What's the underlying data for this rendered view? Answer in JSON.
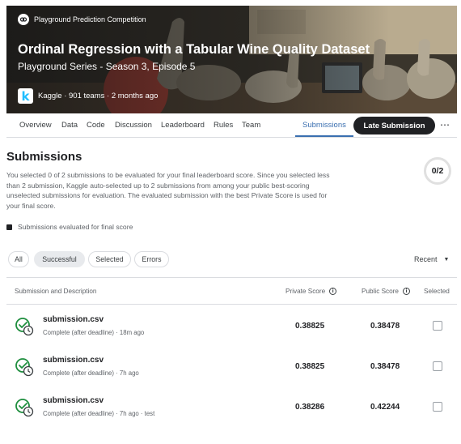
{
  "banner": {
    "competition_type": "Playground Prediction Competition",
    "title": "Ordinal Regression with a Tabular Wine Quality Dataset",
    "subtitle": "Playground Series - Season 3, Episode 5",
    "host_logo_letter": "k",
    "meta": "Kaggle · 901 teams · 2 months ago",
    "icons": [
      "competition-type-icon",
      "kaggle-logo"
    ]
  },
  "tabs": {
    "items": [
      "Overview",
      "Data",
      "Code",
      "Discussion",
      "Leaderboard",
      "Rules",
      "Team",
      "Submissions"
    ],
    "active": "Submissions",
    "late_submission_label": "Late Submission",
    "more_label": "⋯",
    "accent_color": "#3a6fb0"
  },
  "submissions": {
    "title": "Submissions",
    "description": "You selected 0 of 2 submissions to be evaluated for your final leaderboard score. Since you selected less than 2 submission, Kaggle auto-selected up to 2 submissions from among your public best-scoring unselected submissions for evaluation. The evaluated submission with the best Private Score is used for your final score.",
    "selected_count": "0/2",
    "legend_label": "Submissions evaluated for final score"
  },
  "filters": {
    "chips": [
      "All",
      "Successful",
      "Selected",
      "Errors"
    ],
    "active": "Successful",
    "sort_label": "Recent",
    "sort_icon": "caret-down-icon"
  },
  "table": {
    "headers": {
      "description": "Submission and Description",
      "private": "Private Score",
      "public": "Public Score",
      "selected": "Selected"
    },
    "info_glyph": "i",
    "rows": [
      {
        "file": "submission.csv",
        "meta": "Complete (after deadline) · 18m ago",
        "private": "0.38825",
        "public": "0.38478",
        "selected": false
      },
      {
        "file": "submission.csv",
        "meta": "Complete (after deadline) · 7h ago",
        "private": "0.38825",
        "public": "0.38478",
        "selected": false
      },
      {
        "file": "submission.csv",
        "meta": "Complete (after deadline) · 7h ago · test",
        "private": "0.38286",
        "public": "0.42244",
        "selected": false
      }
    ],
    "status_icon": "success-check-clock-icon",
    "success_color": "#1e8e3e"
  }
}
